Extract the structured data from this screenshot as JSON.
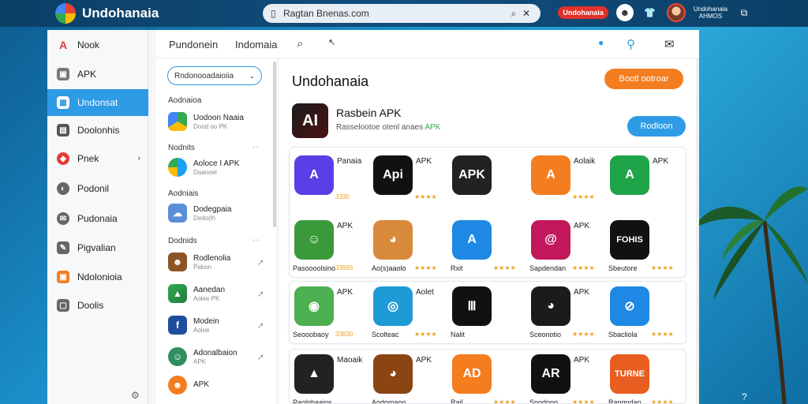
{
  "app": {
    "title": "Undohanaia",
    "url": "Ragtan Bnenas.com"
  },
  "topbar": {
    "badge": "Undohanaia",
    "right_text": "Undohanaia\nAHMOS"
  },
  "sidebar": {
    "items": [
      {
        "label": "Nook",
        "icon": "red-a-icon",
        "color": "#e53935"
      },
      {
        "label": "APK",
        "icon": "grey-square-icon",
        "color": "#777"
      },
      {
        "label": "Undonsat",
        "icon": "grid-icon",
        "color": "#fff",
        "active": true
      },
      {
        "label": "Doolonhis",
        "icon": "doc-icon",
        "color": "#555"
      },
      {
        "label": "Pnek",
        "icon": "shield-icon",
        "color": "#e53935"
      },
      {
        "label": "Podonil",
        "icon": "circle-icon",
        "color": "#666"
      },
      {
        "label": "Pudonaia",
        "icon": "chat-icon",
        "color": "#666"
      },
      {
        "label": "Pigvalian",
        "icon": "pen-icon",
        "color": "#666"
      },
      {
        "label": "Ndolonioia",
        "icon": "orange-square-icon",
        "color": "#f47d20"
      },
      {
        "label": "Doolis",
        "icon": "file-icon",
        "color": "#666"
      }
    ]
  },
  "header": {
    "tab1": "Pundonein",
    "tab2": "Indomaia"
  },
  "mid": {
    "select": "Rndonooadaioiia",
    "sections": [
      {
        "label": "Aodnaioa",
        "count": ""
      },
      {
        "label": "Nodnits",
        "count": "◦ ◦"
      },
      {
        "label": "Aodniais",
        "count": ""
      },
      {
        "label": "Dodnids",
        "count": "◦ ◦"
      }
    ],
    "items": [
      {
        "title": "Uodoon Naaia",
        "sub": "Dood oo PK",
        "color": "#4285f4"
      },
      {
        "title": "Aoloce I APK",
        "sub": "Daanoel",
        "color": "#1da1f2"
      },
      {
        "title": "Dodegpaia",
        "sub": "Dedo(lh",
        "color": "#5a8fd8"
      },
      {
        "title": "Rodlenolia",
        "sub": "Pabon",
        "color": "#8d5524"
      },
      {
        "title": "Aanedan",
        "sub": "Aolee PK",
        "color": "#34a853"
      },
      {
        "title": "Modein",
        "sub": "Aoloe",
        "color": "#1f4f9c"
      },
      {
        "title": "Adonalbaion",
        "sub": "APK",
        "color": "#2f8f5f"
      },
      {
        "title": "APK",
        "sub": "",
        "color": "#f47d20"
      }
    ]
  },
  "content": {
    "title": "Undohanaia",
    "orange_button": "Bootl ootroar",
    "featured": {
      "title": "Rasbein APK",
      "sub": "Rasselootoe otenl anaes",
      "sub_highlight": "APK",
      "icon": "AI"
    },
    "blue_button": "Rodloon",
    "grid": [
      [
        {
          "name": "",
          "label": "Panaia",
          "rating": "3330",
          "color": "#5b3ee6",
          "glyph": "A"
        },
        {
          "name": "",
          "label": "APK",
          "rating": "★★★★",
          "color": "#111",
          "glyph": "Api"
        },
        {
          "name": "",
          "label": "",
          "rating": "",
          "color": "#222",
          "glyph": "APK"
        },
        {
          "name": "",
          "label": "Aolaik",
          "rating": "★★★★",
          "color": "#f47d20",
          "glyph": "A"
        },
        {
          "name": "",
          "label": "APK",
          "rating": "",
          "color": "#1fa44a",
          "glyph": "A"
        }
      ],
      [
        {
          "name": "Pasoooolsino",
          "label": "APK",
          "rating": "33993",
          "color": "#3a9a3a",
          "glyph": "☺"
        },
        {
          "name": "Ao(s)aaolo",
          "label": "",
          "rating": "★★★★",
          "color": "#d88a3a",
          "glyph": "◕"
        },
        {
          "name": "Rxit",
          "label": "",
          "rating": "★★★★",
          "color": "#1e88e5",
          "glyph": "A"
        },
        {
          "name": "Sapdendan",
          "label": "APK",
          "rating": "★★★★",
          "color": "#c2185b",
          "glyph": "@"
        },
        {
          "name": "Sbeutore",
          "label": "",
          "rating": "★★★★",
          "color": "#111",
          "glyph": "FOHIS"
        }
      ],
      [
        {
          "name": "Seooobaoy",
          "label": "APK",
          "rating": "33830",
          "color": "#4caf50",
          "glyph": "◉"
        },
        {
          "name": "Scolteac",
          "label": "Aolet",
          "rating": "★★★★",
          "color": "#1e9bd7",
          "glyph": "◎"
        },
        {
          "name": "Nalit",
          "label": "",
          "rating": "",
          "color": "#111",
          "glyph": "Ⅲ"
        },
        {
          "name": "Sceonotio",
          "label": "APK",
          "rating": "★★★★",
          "color": "#1b1b1b",
          "glyph": "◕"
        },
        {
          "name": "Sbacliola",
          "label": "",
          "rating": "★★★★",
          "color": "#1e88e5",
          "glyph": "⊘"
        }
      ],
      [
        {
          "name": "Paolnbaaios",
          "label": "Maoaik",
          "rating": "",
          "color": "#222",
          "glyph": "▲"
        },
        {
          "name": "Aodomaoo",
          "label": "APK",
          "rating": "",
          "color": "#8b4513",
          "glyph": "◕"
        },
        {
          "name": "Rail",
          "label": "",
          "rating": "★★★★",
          "color": "#f47d20",
          "glyph": "AD"
        },
        {
          "name": "Snodono",
          "label": "APK",
          "rating": "★★★★",
          "color": "#111",
          "glyph": "AR"
        },
        {
          "name": "Rangndan",
          "label": "",
          "rating": "★★★★",
          "color": "#e85d20",
          "glyph": "TURNE"
        }
      ]
    ]
  }
}
